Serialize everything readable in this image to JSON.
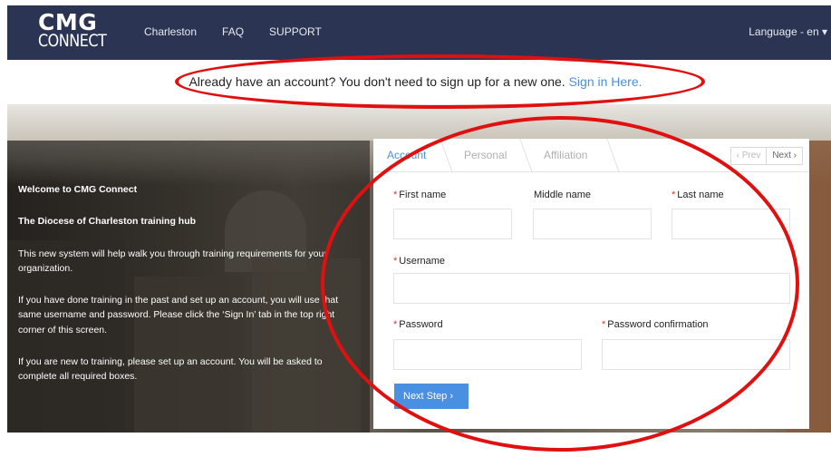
{
  "header": {
    "logo_line1": "CMG",
    "logo_line2": "CONNECT",
    "nav": [
      "Charleston",
      "FAQ",
      "SUPPORT"
    ],
    "language": "Language - en ▾"
  },
  "notice": {
    "text": "Already have an account? You don't need to sign up for a new one.",
    "link": "Sign in Here."
  },
  "intro": {
    "welcome": "Welcome to CMG Connect",
    "hub": "The Diocese of Charleston training hub",
    "p1": "This new system will help walk you through training requirements for your organization.",
    "p2": "If you have done training in the past and set up an account, you will use that same username and password.  Please click the ‘Sign In’ tab in the top right corner of this screen.",
    "p3": "If you are new to training, please set up an account.  You will be asked to complete all required boxes."
  },
  "form": {
    "tabs": [
      "Account",
      "Personal",
      "Affiliation"
    ],
    "pager_prev": "‹  Prev",
    "pager_next": "Next  ›",
    "required_mark": "*",
    "first_name": "First name",
    "middle_name": "Middle name",
    "last_name": "Last name",
    "username": "Username",
    "password": "Password",
    "password_confirmation": "Password confirmation",
    "next_step": "Next Step  ›"
  },
  "colors": {
    "header_bg": "#2b3553",
    "accent": "#4a90e2",
    "annotation": "#e01010",
    "required": "#d33333"
  }
}
